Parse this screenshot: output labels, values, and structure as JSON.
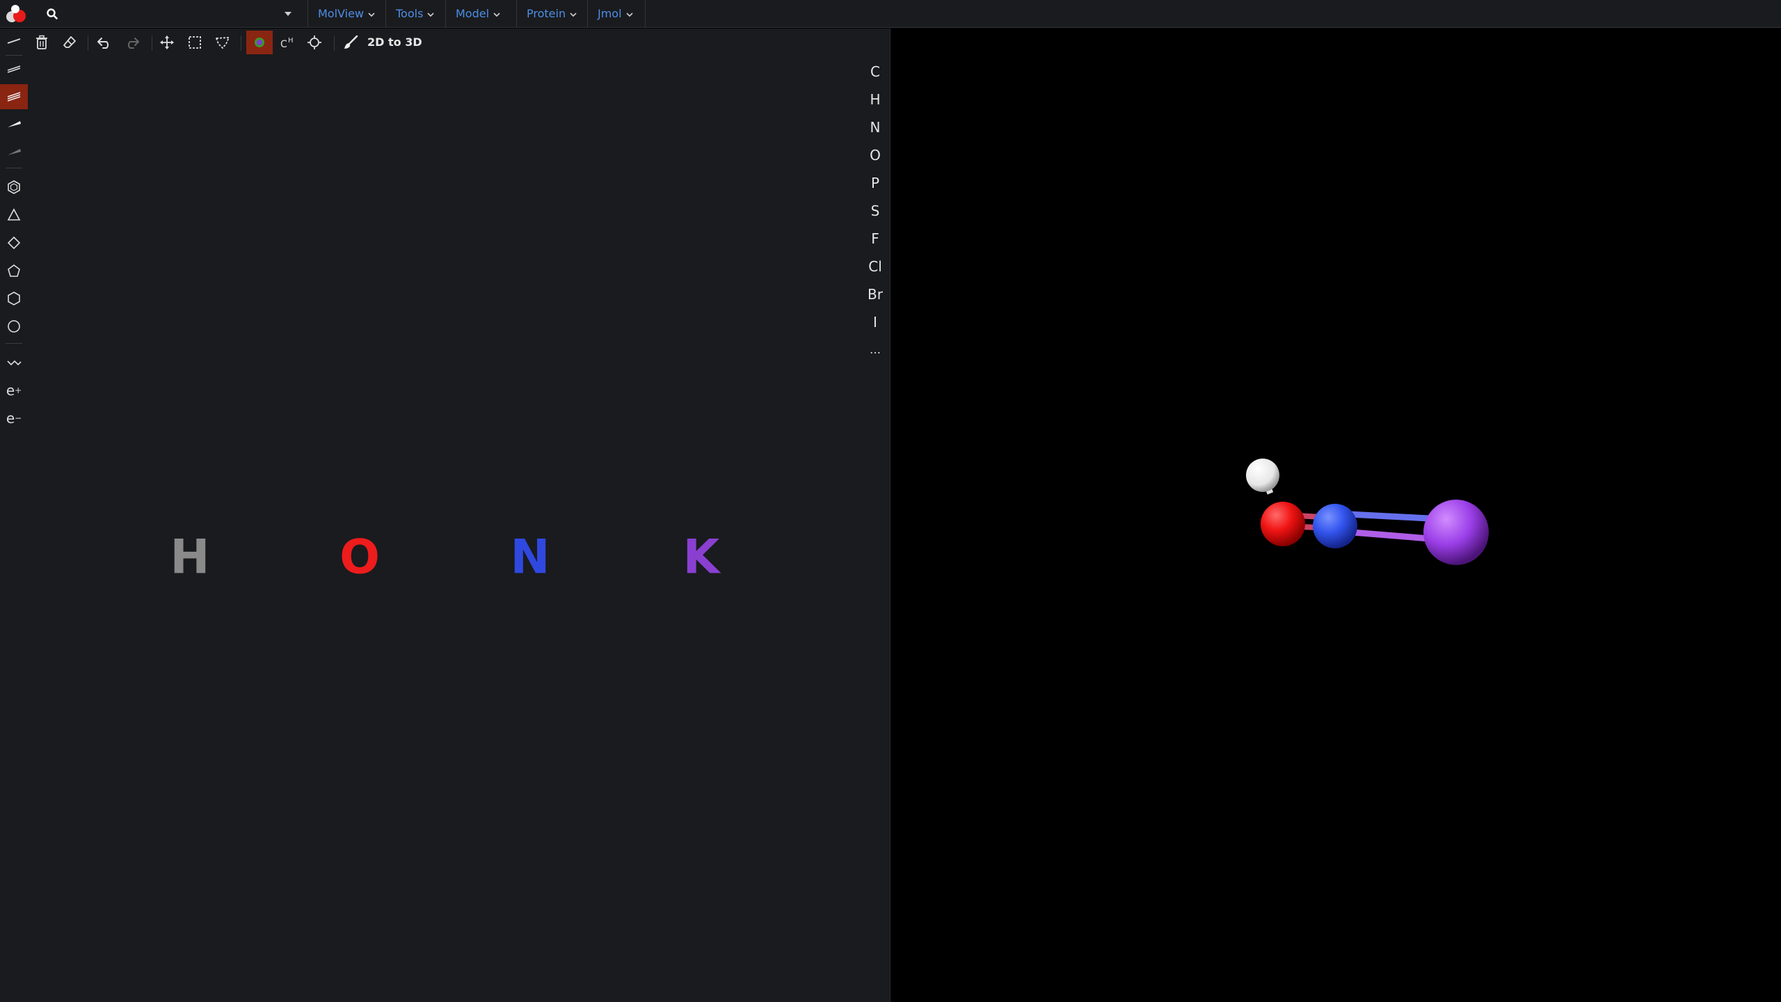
{
  "search": {
    "placeholder": "",
    "value": ""
  },
  "menus": [
    {
      "label": "MolView"
    },
    {
      "label": "Tools"
    },
    {
      "label": "Model"
    },
    {
      "label": "Protein"
    },
    {
      "label": "Jmol"
    }
  ],
  "toolbar": {
    "convert_label": "2D to 3D"
  },
  "element_bar": {
    "elements": [
      "C",
      "H",
      "N",
      "O",
      "P",
      "S",
      "F",
      "Cl",
      "Br",
      "I"
    ],
    "more_label": "…"
  },
  "left_tools": {
    "electron_plus": "e",
    "electron_minus": "e",
    "plus": "+",
    "minus": "−"
  },
  "molecule_2d": {
    "atoms": [
      {
        "symbol": "H",
        "color": "#8a8a8a"
      },
      {
        "symbol": "O",
        "color": "#ee1c1c"
      },
      {
        "symbol": "N",
        "color": "#2f48e0"
      },
      {
        "symbol": "K",
        "color": "#8a3fd1"
      }
    ]
  },
  "molecule_3d": {
    "atoms": [
      "H",
      "O",
      "N",
      "K"
    ],
    "colors": {
      "H": "#ffffff",
      "O": "#ff1a1a",
      "N": "#3355ee",
      "K": "#9b3fe8"
    }
  },
  "colors": {
    "accent_menu": "#4d8ee6",
    "active_tool": "#8a2512",
    "panel_bg": "#1a1b1e"
  }
}
